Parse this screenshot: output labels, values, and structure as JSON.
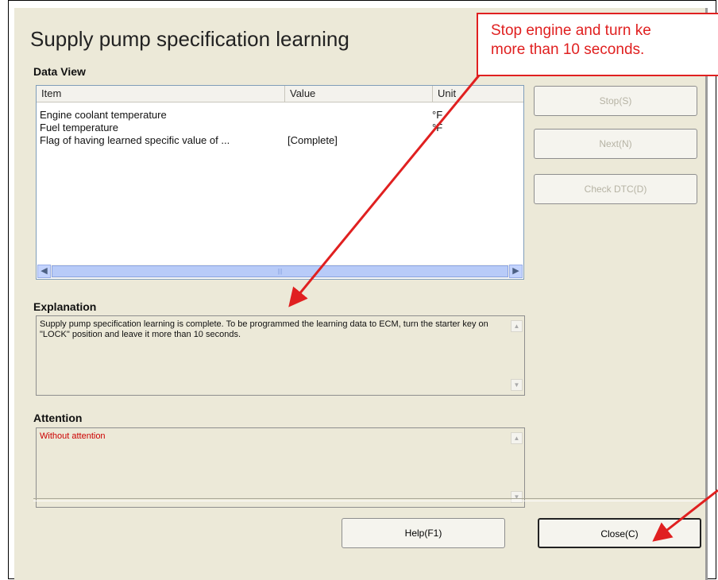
{
  "dialog": {
    "title": "Supply pump specification learning",
    "data_view_label": "Data View",
    "columns": [
      "Item",
      "Value",
      "Unit"
    ],
    "rows": [
      {
        "item": "Engine coolant temperature",
        "value": "",
        "unit": "°F"
      },
      {
        "item": "Fuel temperature",
        "value": "",
        "unit": "°F"
      },
      {
        "item": "Flag of having learned specific value of ...",
        "value": "[Complete]",
        "unit": ""
      }
    ],
    "explanation_label": "Explanation",
    "explanation_text": "Supply pump specification learning is complete. To be programmed the learning data to ECM, turn the starter key on \"LOCK\" position and leave it more than 10 seconds.",
    "attention_label": "Attention",
    "attention_text": "Without attention",
    "buttons": {
      "stop": "Stop(S)",
      "next": "Next(N)",
      "check_dtc": "Check DTC(D)",
      "help": "Help(F1)",
      "close": "Close(C)"
    }
  },
  "callout": {
    "text": "Stop engine and turn ke\nmore than 10 seconds."
  },
  "colors": {
    "annotation": "#e02020",
    "dialog_bg": "#ECE9D8",
    "attention_text": "#cc0000"
  }
}
